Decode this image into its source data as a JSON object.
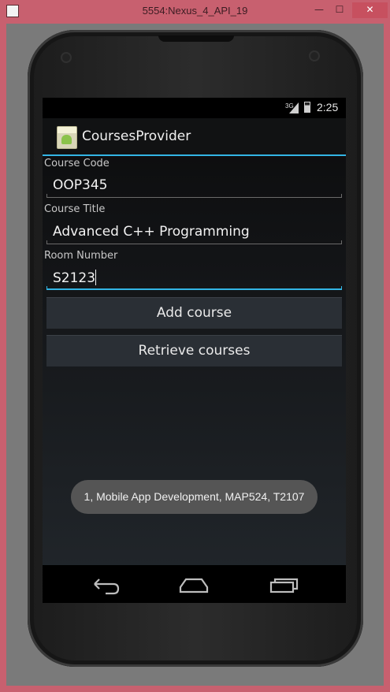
{
  "window": {
    "title": "5554:Nexus_4_API_19",
    "minimize_glyph": "—",
    "maximize_glyph": "☐",
    "close_glyph": "✕"
  },
  "status_bar": {
    "network": "3G",
    "time": "2:25"
  },
  "action_bar": {
    "title": "CoursesProvider",
    "icon": "android-app-icon"
  },
  "form": {
    "course_code": {
      "label": "Course Code",
      "value": "OOP345"
    },
    "course_title": {
      "label": "Course Title",
      "value": "Advanced C++ Programming"
    },
    "room_number": {
      "label": "Room Number",
      "value": "S2123"
    }
  },
  "buttons": {
    "add": "Add course",
    "retrieve": "Retrieve courses"
  },
  "toast": {
    "text": "1, Mobile App Development, MAP524, T2107"
  },
  "nav": {
    "back_icon": "back-icon",
    "home_icon": "home-icon",
    "recents_icon": "recents-icon"
  },
  "colors": {
    "accent": "#33b5e5",
    "window_frame": "#c8606f"
  }
}
